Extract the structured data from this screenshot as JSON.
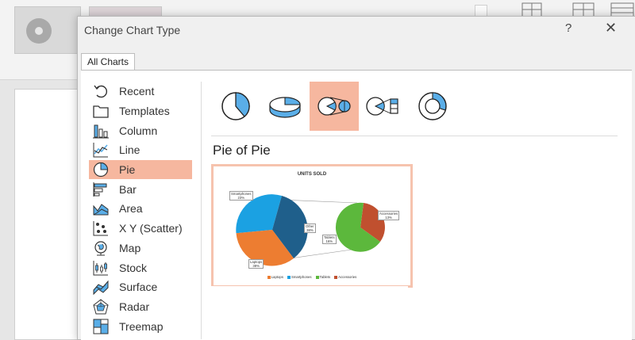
{
  "dialog": {
    "title": "Change Chart Type",
    "help_glyph": "?",
    "close_glyph": "✕"
  },
  "tabs": [
    {
      "label": "All Charts",
      "selected": true
    }
  ],
  "chart_types": [
    {
      "label": "Recent",
      "icon": "recent-icon"
    },
    {
      "label": "Templates",
      "icon": "templates-icon"
    },
    {
      "label": "Column",
      "icon": "column-icon"
    },
    {
      "label": "Line",
      "icon": "line-icon"
    },
    {
      "label": "Pie",
      "icon": "pie-icon",
      "selected": true
    },
    {
      "label": "Bar",
      "icon": "bar-icon"
    },
    {
      "label": "Area",
      "icon": "area-icon"
    },
    {
      "label": "X Y (Scatter)",
      "icon": "scatter-icon"
    },
    {
      "label": "Map",
      "icon": "map-icon"
    },
    {
      "label": "Stock",
      "icon": "stock-icon"
    },
    {
      "label": "Surface",
      "icon": "surface-icon"
    },
    {
      "label": "Radar",
      "icon": "radar-icon"
    },
    {
      "label": "Treemap",
      "icon": "treemap-icon"
    }
  ],
  "subtypes": [
    {
      "icon": "pie-subtype-icon"
    },
    {
      "icon": "3d-pie-subtype-icon"
    },
    {
      "icon": "pie-of-pie-subtype-icon",
      "selected": true
    },
    {
      "icon": "bar-of-pie-subtype-icon"
    },
    {
      "icon": "doughnut-subtype-icon"
    }
  ],
  "selected_subtype_name": "Pie of Pie",
  "preview": {
    "title": "UNITS SOLD",
    "labels": {
      "smartphones": [
        "Smartphones",
        "23%"
      ],
      "other": [
        "Other",
        "38%"
      ],
      "laptops": [
        "Laptops",
        "38%"
      ],
      "accessories": [
        "Accessories",
        "13%"
      ],
      "tablets": [
        "Tablets",
        "16%"
      ]
    },
    "legend": [
      "Laptops",
      "Smartphones",
      "Tablets",
      "Accessories"
    ]
  },
  "colors": {
    "accent_selected": "#f6b79f",
    "laptops": "#ed7d31",
    "smartphones": "#1ba1e2",
    "other": "#1f5f8b",
    "tablets": "#5cb83c",
    "accessories": "#c0502f",
    "icon_blue": "#5aaee8"
  }
}
